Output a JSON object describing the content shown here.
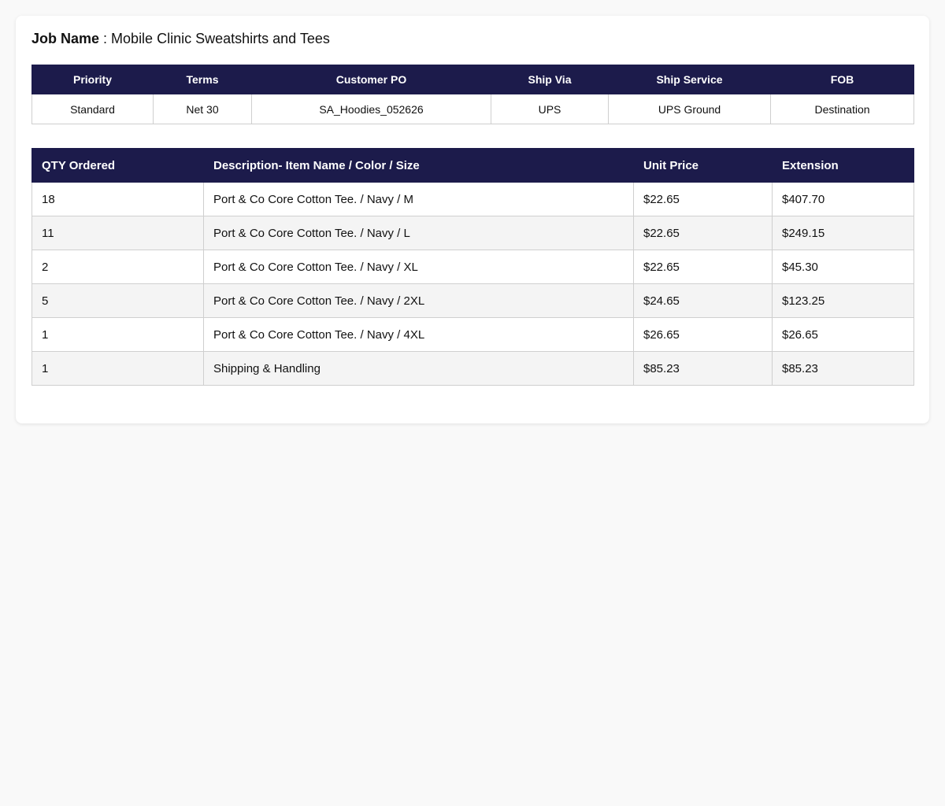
{
  "job": {
    "label": "Job Name",
    "separator": " : ",
    "value": "Mobile Clinic Sweatshirts and Tees"
  },
  "order_info": {
    "headers": [
      "Priority",
      "Terms",
      "Customer PO",
      "Ship Via",
      "Ship Service",
      "FOB"
    ],
    "values": [
      "Standard",
      "Net 30",
      "SA_Hoodies_052626",
      "UPS",
      "UPS Ground",
      "Destination"
    ]
  },
  "line_items": {
    "headers": [
      "QTY Ordered",
      "Description- Item Name / Color / Size",
      "Unit Price",
      "Extension"
    ],
    "rows": [
      {
        "qty": "18",
        "description": "Port & Co Core Cotton Tee. / Navy / M",
        "unit_price": "$22.65",
        "extension": "$407.70"
      },
      {
        "qty": "11",
        "description": "Port & Co Core Cotton Tee. / Navy / L",
        "unit_price": "$22.65",
        "extension": "$249.15"
      },
      {
        "qty": "2",
        "description": "Port & Co Core Cotton Tee. / Navy / XL",
        "unit_price": "$22.65",
        "extension": "$45.30"
      },
      {
        "qty": "5",
        "description": "Port & Co Core Cotton Tee. / Navy / 2XL",
        "unit_price": "$24.65",
        "extension": "$123.25"
      },
      {
        "qty": "1",
        "description": "Port & Co Core Cotton Tee. / Navy / 4XL",
        "unit_price": "$26.65",
        "extension": "$26.65"
      },
      {
        "qty": "1",
        "description": "Shipping & Handling",
        "unit_price": "$85.23",
        "extension": "$85.23"
      }
    ]
  },
  "colors": {
    "header_bg": "#1c1b4b",
    "header_text": "#ffffff",
    "stripe_bg": "#f4f4f4",
    "border": "#cfcfcf"
  }
}
